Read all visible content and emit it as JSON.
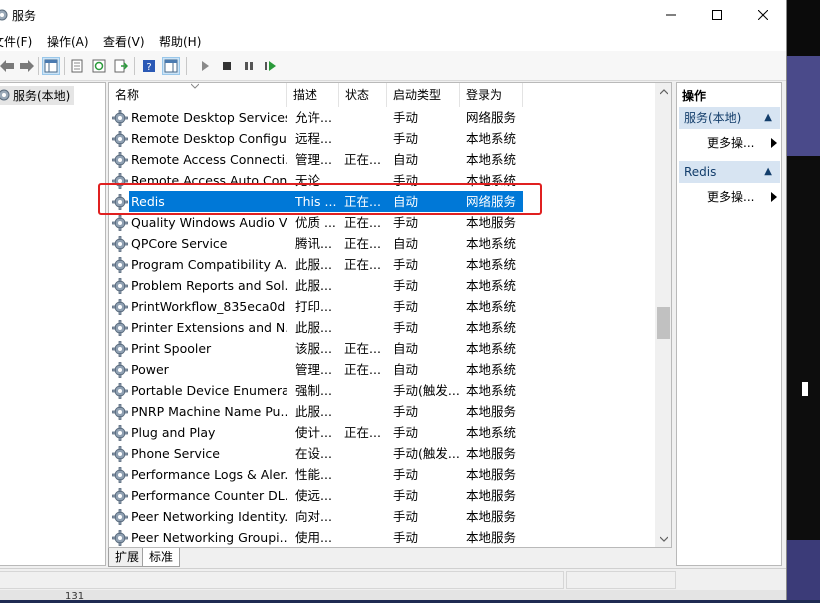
{
  "window": {
    "title": "服务",
    "controls": {
      "minimize": "–",
      "maximize": "☐",
      "close": "✕"
    }
  },
  "menu": [
    "文件(F)",
    "操作(A)",
    "查看(V)",
    "帮助(H)"
  ],
  "tree": {
    "root_label": "服务(本地)"
  },
  "columns": {
    "name": "名称",
    "desc": "描述",
    "status": "状态",
    "startup": "启动类型",
    "logon": "登录为"
  },
  "rows": [
    {
      "name": "Remote Desktop Services",
      "desc": "允许...",
      "status": "",
      "startup": "手动",
      "logon": "网络服务"
    },
    {
      "name": "Remote Desktop Configu...",
      "desc": "远程...",
      "status": "",
      "startup": "手动",
      "logon": "本地系统"
    },
    {
      "name": "Remote Access Connecti...",
      "desc": "管理...",
      "status": "正在...",
      "startup": "自动",
      "logon": "本地系统"
    },
    {
      "name": "Remote Access Auto Con...",
      "desc": "无论...",
      "status": "",
      "startup": "手动",
      "logon": "本地系统"
    },
    {
      "name": "Redis",
      "desc": "This ...",
      "status": "正在...",
      "startup": "自动",
      "logon": "网络服务"
    },
    {
      "name": "Quality Windows Audio V...",
      "desc": "优质 ...",
      "status": "正在...",
      "startup": "手动",
      "logon": "本地服务"
    },
    {
      "name": "QPCore Service",
      "desc": "腾讯...",
      "status": "正在...",
      "startup": "自动",
      "logon": "本地系统"
    },
    {
      "name": "Program Compatibility A...",
      "desc": "此服...",
      "status": "正在...",
      "startup": "手动",
      "logon": "本地系统"
    },
    {
      "name": "Problem Reports and Sol...",
      "desc": "此服...",
      "status": "",
      "startup": "手动",
      "logon": "本地系统"
    },
    {
      "name": "PrintWorkflow_835eca0d",
      "desc": "打印...",
      "status": "",
      "startup": "手动",
      "logon": "本地系统"
    },
    {
      "name": "Printer Extensions and N...",
      "desc": "此服...",
      "status": "",
      "startup": "手动",
      "logon": "本地系统"
    },
    {
      "name": "Print Spooler",
      "desc": "该服...",
      "status": "正在...",
      "startup": "自动",
      "logon": "本地系统"
    },
    {
      "name": "Power",
      "desc": "管理...",
      "status": "正在...",
      "startup": "自动",
      "logon": "本地系统"
    },
    {
      "name": "Portable Device Enumera...",
      "desc": "强制...",
      "status": "",
      "startup": "手动(触发...",
      "logon": "本地系统"
    },
    {
      "name": "PNRP Machine Name Pu...",
      "desc": "此服...",
      "status": "",
      "startup": "手动",
      "logon": "本地服务"
    },
    {
      "name": "Plug and Play",
      "desc": "使计...",
      "status": "正在...",
      "startup": "手动",
      "logon": "本地系统"
    },
    {
      "name": "Phone Service",
      "desc": "在设...",
      "status": "",
      "startup": "手动(触发...",
      "logon": "本地服务"
    },
    {
      "name": "Performance Logs & Aler...",
      "desc": "性能...",
      "status": "",
      "startup": "手动",
      "logon": "本地服务"
    },
    {
      "name": "Performance Counter DL...",
      "desc": "使远...",
      "status": "",
      "startup": "手动",
      "logon": "本地服务"
    },
    {
      "name": "Peer Networking Identity...",
      "desc": "向对...",
      "status": "",
      "startup": "手动",
      "logon": "本地服务"
    },
    {
      "name": "Peer Networking Groupi...",
      "desc": "使用...",
      "status": "",
      "startup": "手动",
      "logon": "本地服务"
    }
  ],
  "selected_row": 4,
  "tabs": [
    "扩展",
    "标准"
  ],
  "actions": {
    "title": "操作",
    "groups": [
      {
        "label": "服务(本地)",
        "more": "更多操..."
      },
      {
        "label": "Redis",
        "more": "更多操..."
      }
    ]
  },
  "status_bar": {
    "number": "131"
  },
  "colors": {
    "selection": "#0078d7",
    "highlight_box": "#e02020",
    "action_header": "#d7e4f2"
  }
}
